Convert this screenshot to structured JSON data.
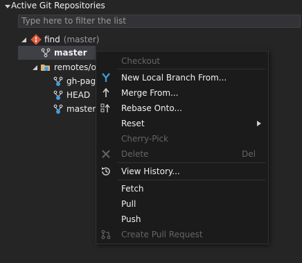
{
  "panel": {
    "title": "Active Git Repositories",
    "filter_placeholder": "Type here to filter the list"
  },
  "tree": {
    "repo_name": "find",
    "repo_branch": "(master)",
    "local_branch": "master",
    "remotes_label": "remotes/or",
    "remote_branches": [
      "gh-page",
      "HEAD",
      "master"
    ]
  },
  "context_menu": {
    "checkout": "Checkout",
    "new_local_branch": "New Local Branch From...",
    "merge_from": "Merge From...",
    "rebase_onto": "Rebase Onto...",
    "reset": "Reset",
    "cherry_pick": "Cherry-Pick",
    "delete": "Delete",
    "delete_shortcut": "Del",
    "view_history": "View History...",
    "fetch": "Fetch",
    "pull": "Pull",
    "push": "Push",
    "create_pull_request": "Create Pull Request"
  },
  "colors": {
    "background": "#252526",
    "menu_background": "#1b1b1c",
    "accent_blue": "#3c9fe0",
    "repo_red": "#e05a3a",
    "disabled_text": "#656565"
  }
}
